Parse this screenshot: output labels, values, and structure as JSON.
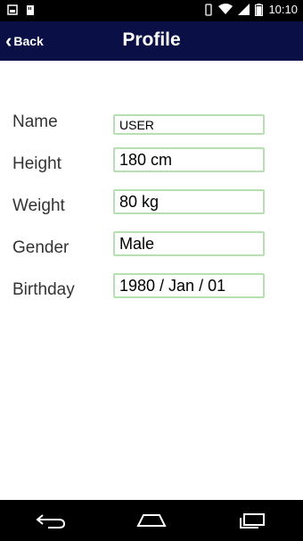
{
  "status_bar": {
    "time": "10:10",
    "icons": [
      "notification-icon",
      "sd-card-icon",
      "vibrate-icon",
      "wifi-icon",
      "signal-icon",
      "battery-icon"
    ]
  },
  "app_bar": {
    "back_label": "Back",
    "title": "Profile",
    "background": "#0a1045"
  },
  "form": {
    "name": {
      "label": "Name",
      "value": "USER"
    },
    "height": {
      "label": "Height",
      "value": "180 cm"
    },
    "weight": {
      "label": "Weight",
      "value": "80 kg"
    },
    "gender": {
      "label": "Gender",
      "value": "Male"
    },
    "birthday": {
      "label": "Birthday",
      "value": "1980 / Jan / 01"
    }
  },
  "nav_bar": {
    "buttons": [
      "back-nav-icon",
      "home-nav-icon",
      "recents-nav-icon"
    ]
  },
  "colors": {
    "field_border": "#b6e0b1"
  }
}
